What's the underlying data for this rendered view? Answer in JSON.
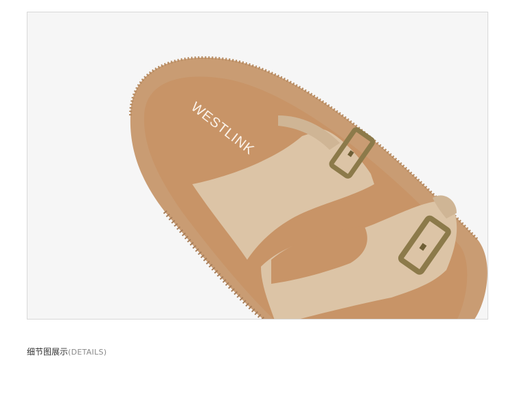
{
  "product_image": {
    "alt_subject": "sandal-detail-photo",
    "logo_text": "WESTLINK",
    "colors": {
      "background": "#f6f6f6",
      "sole": "#c99c73",
      "sole_shadow": "#a87e59",
      "footbed": "#c89467",
      "strap": "#dcc4a6",
      "strap_shadow": "#bfa586",
      "buckle": "#8c7a4a"
    }
  },
  "caption": {
    "zh": "细节图展示",
    "en": "(DETAILS)"
  }
}
